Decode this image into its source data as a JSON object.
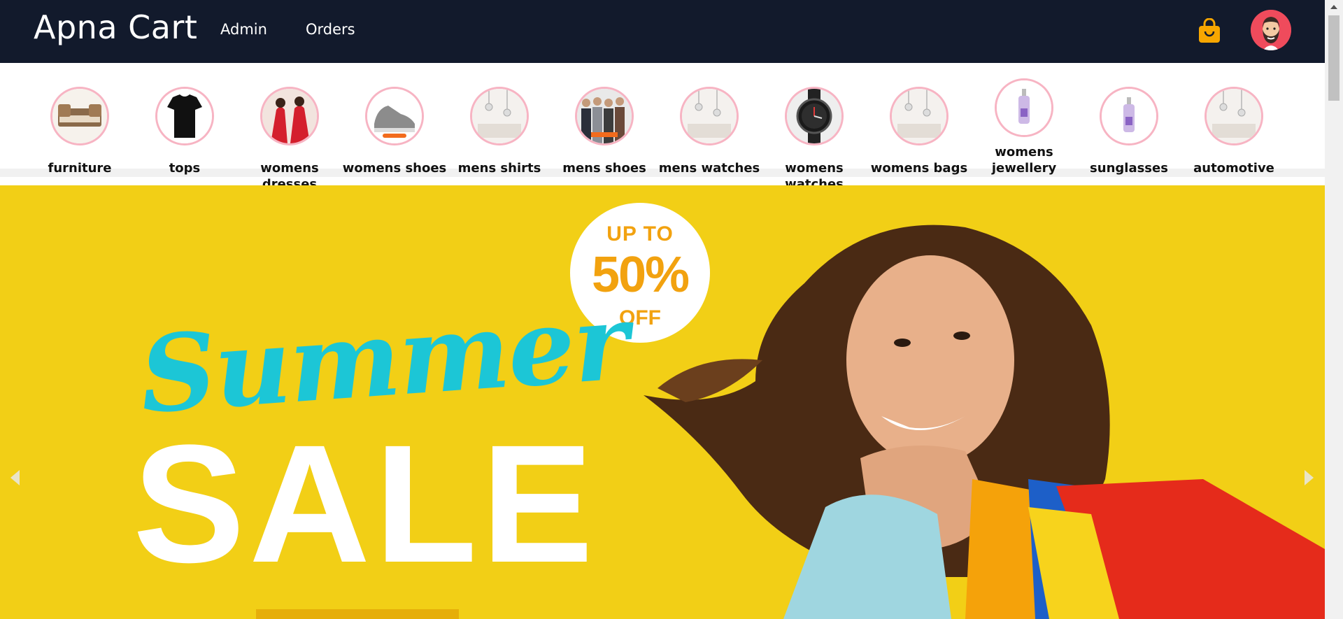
{
  "brand": {
    "name": "Apna Cart"
  },
  "nav": {
    "links": [
      "Admin",
      "Orders"
    ]
  },
  "header_icons": {
    "cart_icon": "shopping-bag-icon",
    "avatar_icon": "user-avatar-icon",
    "cart_color": "#f7a600",
    "avatar_bg": "#ef4b5c"
  },
  "categories": [
    {
      "label": "furniture",
      "thumb": "bed"
    },
    {
      "label": "tops",
      "thumb": "tshirt"
    },
    {
      "label": "womens dresses",
      "thumb": "red-dress"
    },
    {
      "label": "womens shoes",
      "thumb": "sneaker"
    },
    {
      "label": "mens shirts",
      "thumb": "room"
    },
    {
      "label": "mens shoes",
      "thumb": "group"
    },
    {
      "label": "mens watches",
      "thumb": "room"
    },
    {
      "label": "womens watches",
      "thumb": "watch"
    },
    {
      "label": "womens bags",
      "thumb": "room"
    },
    {
      "label": "womens jewellery",
      "thumb": "bottle"
    },
    {
      "label": "sunglasses",
      "thumb": "bottle"
    },
    {
      "label": "automotive",
      "thumb": "room"
    }
  ],
  "hero": {
    "badge_top": "UP TO",
    "badge_mid": "50%",
    "badge_bot": "OFF",
    "script_text": "Summer",
    "headline": "SALE",
    "bg_color": "#f2cf16",
    "accent_color": "#1cc6d6",
    "badge_color": "#f2a20f"
  },
  "carousel": {
    "prev_icon": "chevron-left-icon",
    "next_icon": "chevron-right-icon"
  },
  "colors": {
    "navbar": "#121a2c",
    "thumb_border": "#f7b4c3"
  }
}
